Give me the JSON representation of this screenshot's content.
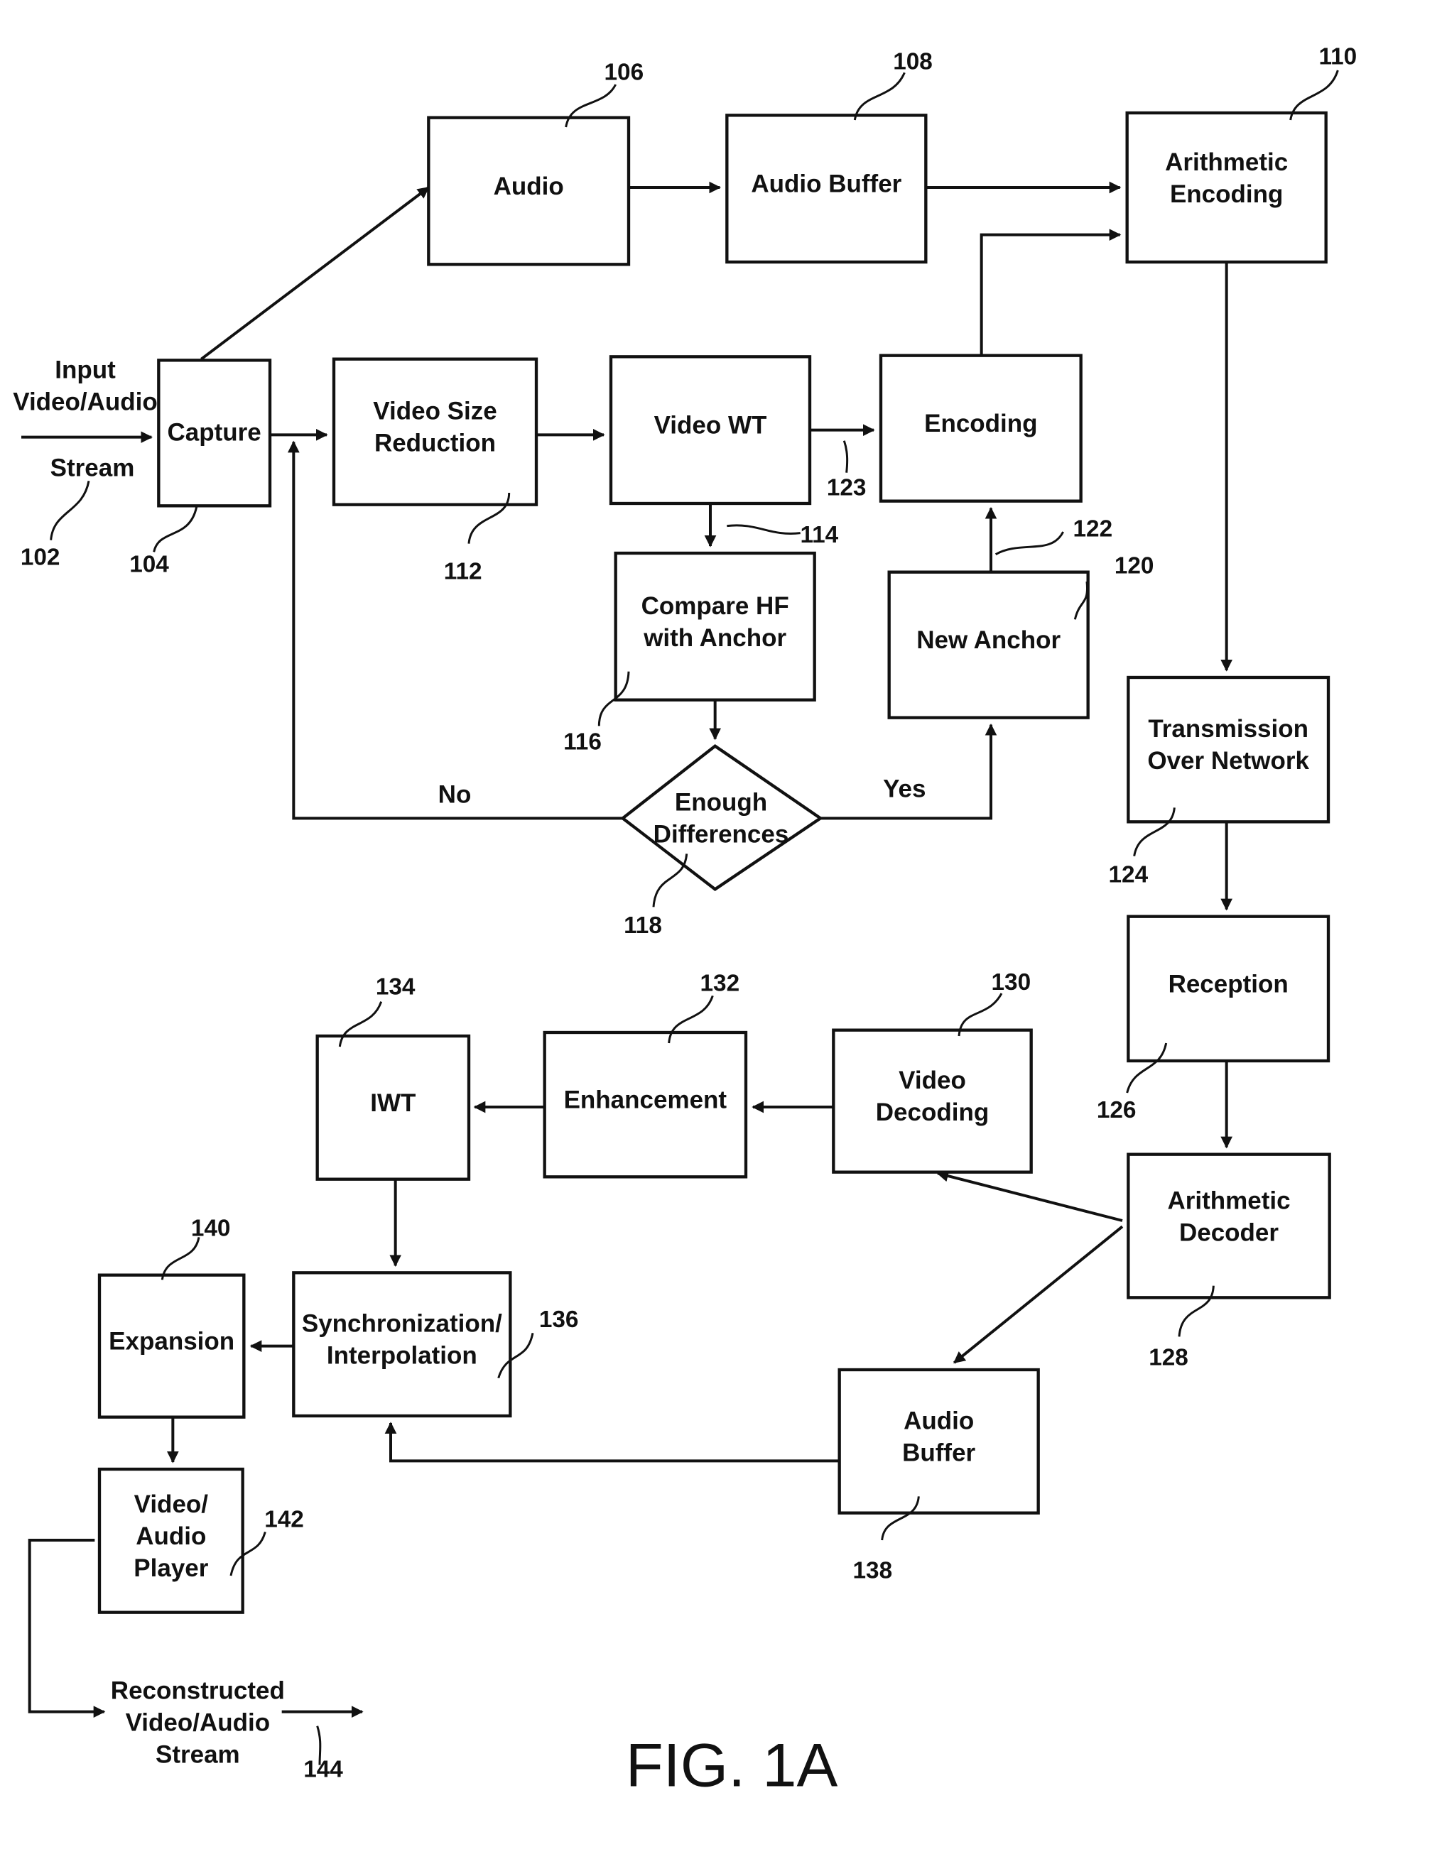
{
  "figure_label": "FIG. 1A",
  "blocks": {
    "capture": {
      "lines": [
        "Capture"
      ],
      "ref": "104"
    },
    "audio": {
      "lines": [
        "Audio"
      ],
      "ref": "106"
    },
    "audio_buffer": {
      "lines": [
        "Audio Buffer"
      ],
      "ref": "108"
    },
    "arith_enc": {
      "lines": [
        "Arithmetic",
        "Encoding"
      ],
      "ref": "110"
    },
    "vsr": {
      "lines": [
        "Video Size",
        "Reduction"
      ],
      "ref": "112"
    },
    "vwt": {
      "lines": [
        "Video WT"
      ],
      "ref": "114"
    },
    "compare": {
      "lines": [
        "Compare HF",
        "with Anchor"
      ],
      "ref": "116"
    },
    "decision": {
      "lines": [
        "Enough",
        "Differences"
      ],
      "ref": "118",
      "no": "No",
      "yes": "Yes"
    },
    "new_anchor": {
      "lines": [
        "New Anchor"
      ],
      "ref": "120"
    },
    "encoding": {
      "lines": [
        "Encoding"
      ],
      "ref_in_top": "122",
      "ref_in_left": "123"
    },
    "transmission": {
      "lines": [
        "Transmission",
        "Over Network"
      ],
      "ref": "124"
    },
    "reception": {
      "lines": [
        "Reception"
      ],
      "ref": "126"
    },
    "arith_dec": {
      "lines": [
        "Arithmetic",
        "Decoder"
      ],
      "ref": "128"
    },
    "video_dec": {
      "lines": [
        "Video",
        "Decoding"
      ],
      "ref": "130"
    },
    "enhancement": {
      "lines": [
        "Enhancement"
      ],
      "ref": "132"
    },
    "iwt": {
      "lines": [
        "IWT"
      ],
      "ref": "134"
    },
    "sync": {
      "lines": [
        "Synchronization/",
        "Interpolation"
      ],
      "ref": "136"
    },
    "audio_buffer2": {
      "lines": [
        "Audio",
        "Buffer"
      ],
      "ref": "138"
    },
    "expansion": {
      "lines": [
        "Expansion"
      ],
      "ref": "140"
    },
    "player": {
      "lines": [
        "Video/",
        "Audio",
        "Player"
      ],
      "ref": "142"
    }
  },
  "input_stream": {
    "lines": [
      "Input",
      "Video/Audio",
      "Stream"
    ],
    "ref": "102"
  },
  "output_stream": {
    "lines": [
      "Reconstructed",
      "Video/Audio",
      "Stream"
    ],
    "ref": "144"
  }
}
